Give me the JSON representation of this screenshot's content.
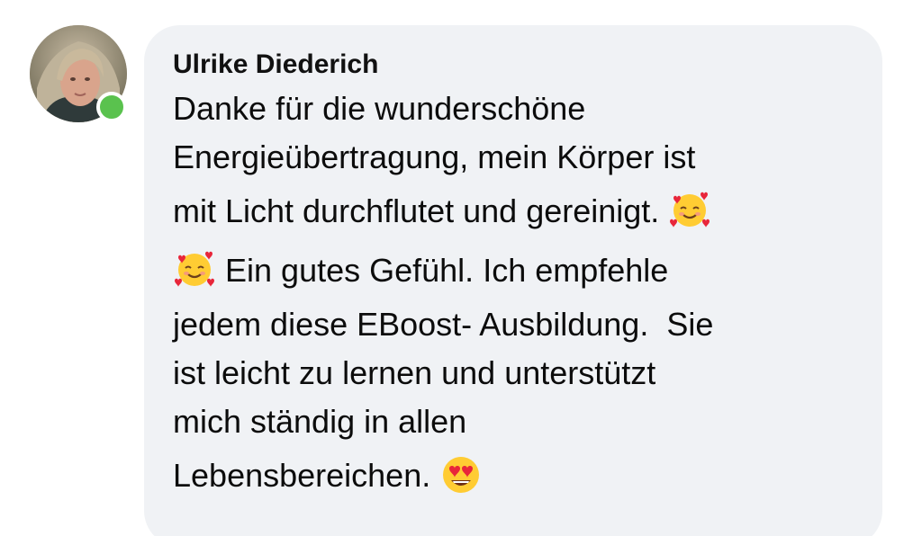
{
  "comment": {
    "author": "Ulrike Diederich",
    "online": true,
    "lines": [
      "Danke für die wunderschöne",
      "Energieübertragung, mein Körper ist",
      "mit Licht durchflutet und gereinigt.",
      "Ein gutes Gefühl. Ich empfehle",
      "jedem diese EBoost- Ausbildung.  Sie",
      "ist leicht zu lernen und unterstützt",
      "mich ständig in allen",
      "Lebensbereichen."
    ]
  },
  "emojis": {
    "hearts_face": "smiling-face-with-hearts-icon",
    "heart_eyes": "heart-eyes-face-icon"
  },
  "colors": {
    "bubble_bg": "#f0f2f5",
    "presence": "#5ac24e"
  }
}
